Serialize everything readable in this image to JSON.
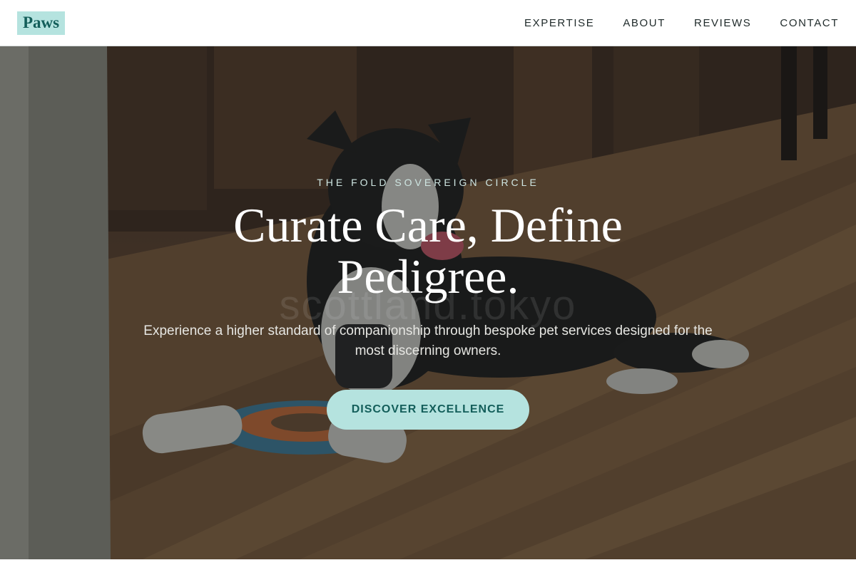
{
  "header": {
    "logo": "Paws",
    "nav": [
      {
        "label": "EXPERTISE"
      },
      {
        "label": "ABOUT"
      },
      {
        "label": "REVIEWS"
      },
      {
        "label": "CONTACT"
      }
    ]
  },
  "hero": {
    "eyebrow": "THE FOLD SOVEREIGN CIRCLE",
    "headline": "Curate Care, Define Pedigree.",
    "subtext": "Experience a higher standard of companionship through bespoke pet services designed for the most discerning owners.",
    "cta_label": "DISCOVER EXCELLENCE",
    "watermark": "scottland.tokyo",
    "image_description": "dog-on-wooden-floor-photo"
  },
  "colors": {
    "accent": "#b5e3df",
    "accent_text": "#135e5a",
    "nav_text": "#1f2a2a"
  }
}
